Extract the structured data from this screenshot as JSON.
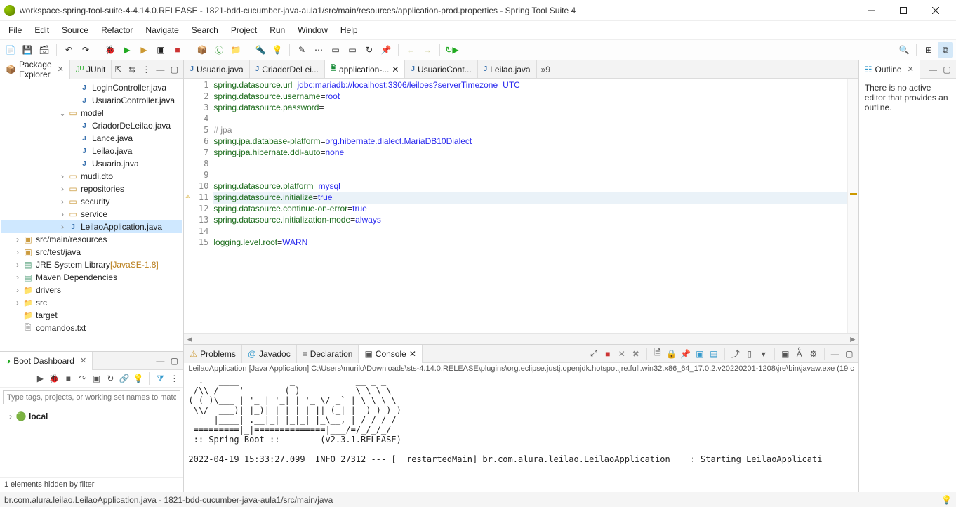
{
  "window": {
    "title": "workspace-spring-tool-suite-4-4.14.0.RELEASE - 1821-bdd-cucumber-java-aula1/src/main/resources/application-prod.properties - Spring Tool Suite 4"
  },
  "menu": [
    "File",
    "Edit",
    "Source",
    "Refactor",
    "Navigate",
    "Search",
    "Project",
    "Run",
    "Window",
    "Help"
  ],
  "packageExplorer": {
    "title": "Package Explorer",
    "junit": "JUnit",
    "items": [
      {
        "depth": 6,
        "twisty": "",
        "icon": "java-icon",
        "label": "LoginController.java"
      },
      {
        "depth": 6,
        "twisty": "",
        "icon": "java-icon",
        "label": "UsuarioController.java"
      },
      {
        "depth": 5,
        "twisty": "v",
        "icon": "pkg-icon",
        "label": "model"
      },
      {
        "depth": 6,
        "twisty": "",
        "icon": "java-icon",
        "label": "CriadorDeLeilao.java"
      },
      {
        "depth": 6,
        "twisty": "",
        "icon": "java-icon",
        "label": "Lance.java"
      },
      {
        "depth": 6,
        "twisty": "",
        "icon": "java-icon",
        "label": "Leilao.java"
      },
      {
        "depth": 6,
        "twisty": "",
        "icon": "java-icon",
        "label": "Usuario.java"
      },
      {
        "depth": 5,
        "twisty": ">",
        "icon": "pkg-icon",
        "label": "mudi.dto"
      },
      {
        "depth": 5,
        "twisty": ">",
        "icon": "pkg-icon",
        "label": "repositories"
      },
      {
        "depth": 5,
        "twisty": ">",
        "icon": "pkg-icon",
        "label": "security"
      },
      {
        "depth": 5,
        "twisty": ">",
        "icon": "pkg-icon",
        "label": "service"
      },
      {
        "depth": 5,
        "twisty": ">",
        "icon": "java-icon",
        "label": "LeilaoApplication.java",
        "selected": true
      },
      {
        "depth": 1,
        "twisty": ">",
        "icon": "src-icon",
        "label": "src/main/resources"
      },
      {
        "depth": 1,
        "twisty": ">",
        "icon": "src-icon",
        "label": "src/test/java"
      },
      {
        "depth": 1,
        "twisty": ">",
        "icon": "lib-icon",
        "label": "JRE System Library",
        "suffix": "[JavaSE-1.8]"
      },
      {
        "depth": 1,
        "twisty": ">",
        "icon": "lib-icon",
        "label": "Maven Dependencies"
      },
      {
        "depth": 1,
        "twisty": ">",
        "icon": "folder-icon",
        "label": "drivers"
      },
      {
        "depth": 1,
        "twisty": ">",
        "icon": "folder-icon",
        "label": "src"
      },
      {
        "depth": 1,
        "twisty": "",
        "icon": "folder-icon",
        "label": "target"
      },
      {
        "depth": 1,
        "twisty": "",
        "icon": "txt-icon",
        "label": "comandos.txt"
      }
    ]
  },
  "bootDash": {
    "title": "Boot Dashboard",
    "filterPlaceholder": "Type tags, projects, or working set names to match (incl. * an",
    "local": "local",
    "status": "1 elements hidden by filter"
  },
  "editorTabs": [
    {
      "label": "Usuario.java",
      "icon": "j"
    },
    {
      "label": "CriadorDeLei...",
      "icon": "j"
    },
    {
      "label": "application-...",
      "icon": "p",
      "active": true,
      "close": true
    },
    {
      "label": "UsuarioCont...",
      "icon": "j"
    },
    {
      "label": "Leilao.java",
      "icon": "j"
    }
  ],
  "editorOverflow": "»9",
  "code": {
    "lines": [
      {
        "n": 1,
        "segs": [
          [
            "k",
            "spring.datasource.url"
          ],
          [
            "",
            "="
          ],
          [
            "v",
            "jdbc:mariadb://localhost:3306/leiloes?serverTimezone=UTC"
          ]
        ]
      },
      {
        "n": 2,
        "segs": [
          [
            "k",
            "spring.datasource.username"
          ],
          [
            "",
            "="
          ],
          [
            "v",
            "root"
          ]
        ]
      },
      {
        "n": 3,
        "segs": [
          [
            "k",
            "spring.datasource.password"
          ],
          [
            "",
            "="
          ]
        ]
      },
      {
        "n": 4,
        "segs": []
      },
      {
        "n": 5,
        "segs": [
          [
            "c",
            "# jpa"
          ]
        ]
      },
      {
        "n": 6,
        "segs": [
          [
            "k",
            "spring.jpa.database-platform"
          ],
          [
            "",
            "="
          ],
          [
            "v",
            "org.hibernate.dialect.MariaDB10Dialect"
          ]
        ]
      },
      {
        "n": 7,
        "segs": [
          [
            "k",
            "spring.jpa.hibernate.ddl-auto"
          ],
          [
            "",
            "="
          ],
          [
            "v",
            "none"
          ]
        ]
      },
      {
        "n": 8,
        "segs": []
      },
      {
        "n": 9,
        "segs": []
      },
      {
        "n": 10,
        "segs": [
          [
            "k",
            "spring.datasource.platform"
          ],
          [
            "",
            "="
          ],
          [
            "v",
            "mysql"
          ]
        ]
      },
      {
        "n": 11,
        "warn": true,
        "hl": true,
        "segs": [
          [
            "k",
            "spring.datasource.initialize"
          ],
          [
            "",
            "="
          ],
          [
            "v",
            "true"
          ]
        ]
      },
      {
        "n": 12,
        "segs": [
          [
            "k",
            "spring.datasource.continue-on-error"
          ],
          [
            "",
            "="
          ],
          [
            "v",
            "true"
          ]
        ]
      },
      {
        "n": 13,
        "segs": [
          [
            "k",
            "spring.datasource.initialization-mode"
          ],
          [
            "",
            "="
          ],
          [
            "v",
            "always"
          ]
        ]
      },
      {
        "n": 14,
        "segs": []
      },
      {
        "n": 15,
        "segs": [
          [
            "k",
            "logging.level.root"
          ],
          [
            "",
            "="
          ],
          [
            "v",
            "WARN"
          ]
        ]
      }
    ]
  },
  "bottomTabs": [
    {
      "label": "Problems",
      "icon": "⚠"
    },
    {
      "label": "Javadoc",
      "icon": "@"
    },
    {
      "label": "Declaration",
      "icon": "≡"
    },
    {
      "label": "Console",
      "icon": "▣",
      "active": true,
      "close": true
    }
  ],
  "console": {
    "title": "LeilaoApplication [Java Application] C:\\Users\\murilo\\Downloads\\sts-4.14.0.RELEASE\\plugins\\org.eclipse.justj.openjdk.hotspot.jre.full.win32.x86_64_17.0.2.v20220201-1208\\jre\\bin\\javaw.exe (19 c",
    "out": "  .   ____          _            __ _ _\n /\\\\ / ___'_ __ _ _(_)_ __  __ _ \\ \\ \\ \\\n( ( )\\___ | '_ | '_| | '_ \\/ _` | \\ \\ \\ \\\n \\\\/  ___)| |_)| | | | | || (_| |  ) ) ) )\n  '  |____| .__|_| |_|_| |_\\__, | / / / /\n =========|_|==============|___/=/_/_/_/\n :: Spring Boot ::        (v2.3.1.RELEASE)\n\n2022-04-19 15:33:27.099  INFO 27312 --- [  restartedMain] br.com.alura.leilao.LeilaoApplication    : Starting LeilaoApplicati"
  },
  "outline": {
    "title": "Outline",
    "msg": "There is no active editor that provides an outline."
  },
  "statusbar": {
    "left": "br.com.alura.leilao.LeilaoApplication.java - 1821-bdd-cucumber-java-aula1/src/main/java"
  }
}
